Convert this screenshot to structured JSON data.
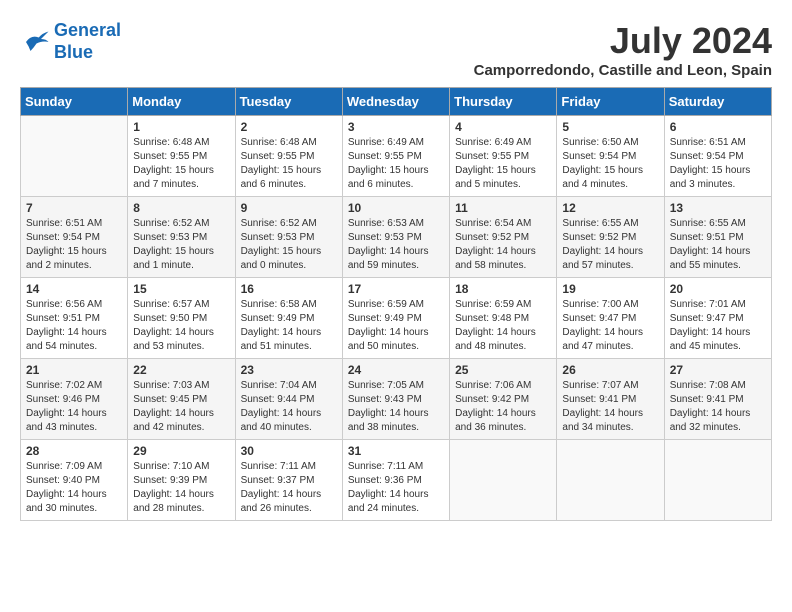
{
  "header": {
    "logo_line1": "General",
    "logo_line2": "Blue",
    "month_title": "July 2024",
    "location": "Camporredondo, Castille and Leon, Spain"
  },
  "days_of_week": [
    "Sunday",
    "Monday",
    "Tuesday",
    "Wednesday",
    "Thursday",
    "Friday",
    "Saturday"
  ],
  "weeks": [
    [
      {
        "day": "",
        "content": ""
      },
      {
        "day": "1",
        "content": "Sunrise: 6:48 AM\nSunset: 9:55 PM\nDaylight: 15 hours\nand 7 minutes."
      },
      {
        "day": "2",
        "content": "Sunrise: 6:48 AM\nSunset: 9:55 PM\nDaylight: 15 hours\nand 6 minutes."
      },
      {
        "day": "3",
        "content": "Sunrise: 6:49 AM\nSunset: 9:55 PM\nDaylight: 15 hours\nand 6 minutes."
      },
      {
        "day": "4",
        "content": "Sunrise: 6:49 AM\nSunset: 9:55 PM\nDaylight: 15 hours\nand 5 minutes."
      },
      {
        "day": "5",
        "content": "Sunrise: 6:50 AM\nSunset: 9:54 PM\nDaylight: 15 hours\nand 4 minutes."
      },
      {
        "day": "6",
        "content": "Sunrise: 6:51 AM\nSunset: 9:54 PM\nDaylight: 15 hours\nand 3 minutes."
      }
    ],
    [
      {
        "day": "7",
        "content": "Sunrise: 6:51 AM\nSunset: 9:54 PM\nDaylight: 15 hours\nand 2 minutes."
      },
      {
        "day": "8",
        "content": "Sunrise: 6:52 AM\nSunset: 9:53 PM\nDaylight: 15 hours\nand 1 minute."
      },
      {
        "day": "9",
        "content": "Sunrise: 6:52 AM\nSunset: 9:53 PM\nDaylight: 15 hours\nand 0 minutes."
      },
      {
        "day": "10",
        "content": "Sunrise: 6:53 AM\nSunset: 9:53 PM\nDaylight: 14 hours\nand 59 minutes."
      },
      {
        "day": "11",
        "content": "Sunrise: 6:54 AM\nSunset: 9:52 PM\nDaylight: 14 hours\nand 58 minutes."
      },
      {
        "day": "12",
        "content": "Sunrise: 6:55 AM\nSunset: 9:52 PM\nDaylight: 14 hours\nand 57 minutes."
      },
      {
        "day": "13",
        "content": "Sunrise: 6:55 AM\nSunset: 9:51 PM\nDaylight: 14 hours\nand 55 minutes."
      }
    ],
    [
      {
        "day": "14",
        "content": "Sunrise: 6:56 AM\nSunset: 9:51 PM\nDaylight: 14 hours\nand 54 minutes."
      },
      {
        "day": "15",
        "content": "Sunrise: 6:57 AM\nSunset: 9:50 PM\nDaylight: 14 hours\nand 53 minutes."
      },
      {
        "day": "16",
        "content": "Sunrise: 6:58 AM\nSunset: 9:49 PM\nDaylight: 14 hours\nand 51 minutes."
      },
      {
        "day": "17",
        "content": "Sunrise: 6:59 AM\nSunset: 9:49 PM\nDaylight: 14 hours\nand 50 minutes."
      },
      {
        "day": "18",
        "content": "Sunrise: 6:59 AM\nSunset: 9:48 PM\nDaylight: 14 hours\nand 48 minutes."
      },
      {
        "day": "19",
        "content": "Sunrise: 7:00 AM\nSunset: 9:47 PM\nDaylight: 14 hours\nand 47 minutes."
      },
      {
        "day": "20",
        "content": "Sunrise: 7:01 AM\nSunset: 9:47 PM\nDaylight: 14 hours\nand 45 minutes."
      }
    ],
    [
      {
        "day": "21",
        "content": "Sunrise: 7:02 AM\nSunset: 9:46 PM\nDaylight: 14 hours\nand 43 minutes."
      },
      {
        "day": "22",
        "content": "Sunrise: 7:03 AM\nSunset: 9:45 PM\nDaylight: 14 hours\nand 42 minutes."
      },
      {
        "day": "23",
        "content": "Sunrise: 7:04 AM\nSunset: 9:44 PM\nDaylight: 14 hours\nand 40 minutes."
      },
      {
        "day": "24",
        "content": "Sunrise: 7:05 AM\nSunset: 9:43 PM\nDaylight: 14 hours\nand 38 minutes."
      },
      {
        "day": "25",
        "content": "Sunrise: 7:06 AM\nSunset: 9:42 PM\nDaylight: 14 hours\nand 36 minutes."
      },
      {
        "day": "26",
        "content": "Sunrise: 7:07 AM\nSunset: 9:41 PM\nDaylight: 14 hours\nand 34 minutes."
      },
      {
        "day": "27",
        "content": "Sunrise: 7:08 AM\nSunset: 9:41 PM\nDaylight: 14 hours\nand 32 minutes."
      }
    ],
    [
      {
        "day": "28",
        "content": "Sunrise: 7:09 AM\nSunset: 9:40 PM\nDaylight: 14 hours\nand 30 minutes."
      },
      {
        "day": "29",
        "content": "Sunrise: 7:10 AM\nSunset: 9:39 PM\nDaylight: 14 hours\nand 28 minutes."
      },
      {
        "day": "30",
        "content": "Sunrise: 7:11 AM\nSunset: 9:37 PM\nDaylight: 14 hours\nand 26 minutes."
      },
      {
        "day": "31",
        "content": "Sunrise: 7:11 AM\nSunset: 9:36 PM\nDaylight: 14 hours\nand 24 minutes."
      },
      {
        "day": "",
        "content": ""
      },
      {
        "day": "",
        "content": ""
      },
      {
        "day": "",
        "content": ""
      }
    ]
  ]
}
